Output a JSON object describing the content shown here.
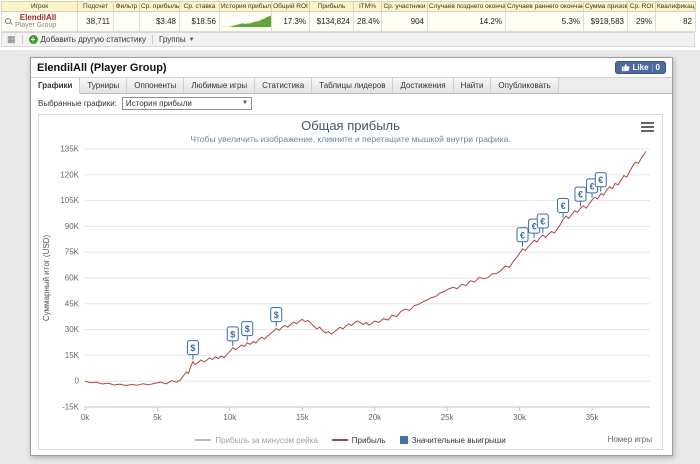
{
  "colors": {
    "accent_red": "#AA4643",
    "accent_blue": "#4572A7",
    "flag_blue": "#3c6aa6",
    "sparkline_green": "#63a33c",
    "header_bg": "#fbf4c6",
    "like_blue": "#4e69a2"
  },
  "table": {
    "headers": [
      "Игрок",
      "Подсчет",
      "Фильтр",
      "Ср. прибыль",
      "Ср. ставка",
      "История прибыли",
      "Общий ROI",
      "Прибыль",
      "ITM%",
      "Ср. участники",
      "Случаев позднего окончания",
      "Случаев раннего окончания",
      "Сумма призов",
      "Ср. ROI",
      "Квалификация"
    ],
    "row": {
      "player": "ElendilAll",
      "player_sub": "Player Group",
      "count": "38,711",
      "filter": "",
      "avg_profit": "$3.48",
      "avg_stake": "$18.56",
      "total_roi": "17.3%",
      "profit": "$134,824",
      "itm": "28.4%",
      "avg_entrants": "904",
      "late_finish": "14.2%",
      "early_finish": "5.3%",
      "total_prizes": "$918,583",
      "avg_roi": "29%",
      "qualification": "82"
    }
  },
  "toolbar": {
    "add_stat": "Добавить другую статистику",
    "groups": "Группы"
  },
  "panel": {
    "title": "ElendilAll (Player Group)",
    "like_label": "Like",
    "like_count": "0",
    "tabs": [
      "Графики",
      "Турниры",
      "Оппоненты",
      "Любимые игры",
      "Статистика",
      "Таблицы лидеров",
      "Достижения",
      "Найти",
      "Опубликовать"
    ],
    "selected_graphs_label": "Выбранные графики:",
    "selected_graph": "История прибыли"
  },
  "chart_data": {
    "type": "line",
    "title": "Общая прибыль",
    "subtitle": "Чтобы увеличить изображение, кликните и перетащите мышкой внутри графика.",
    "xlabel": "Номер игры",
    "ylabel": "Суммарный итог (USD)",
    "y_unit": "thousand USD",
    "xlim": [
      0,
      39
    ],
    "ylim": [
      -15,
      135
    ],
    "grid": "horizontal",
    "legend_position": "bottom",
    "xticks": {
      "values": [
        0,
        5,
        10,
        15,
        20,
        25,
        30,
        35
      ],
      "labels": [
        "0k",
        "5k",
        "10k",
        "15k",
        "20k",
        "25k",
        "30k",
        "35k"
      ]
    },
    "yticks": {
      "values": [
        -15,
        0,
        15,
        30,
        45,
        60,
        75,
        90,
        105,
        120,
        135
      ],
      "labels": [
        "-15K",
        "0",
        "15K",
        "30K",
        "45K",
        "60K",
        "75K",
        "90K",
        "105K",
        "120K",
        "135K"
      ]
    },
    "legend": [
      {
        "label": "Прибыль за минусом рейка",
        "type": "line",
        "color": "#b8b8b8",
        "text_color": "#a0a0a0"
      },
      {
        "label": "Прибыль",
        "type": "line",
        "color": "#AA4643",
        "text_color": "#333333"
      },
      {
        "label": "Значительные выигрыши",
        "type": "square",
        "color": "#4572A7",
        "text_color": "#333333"
      }
    ],
    "series": [
      {
        "name": "Прибыль",
        "color": "#AA4643",
        "points": [
          [
            0,
            0
          ],
          [
            0.4,
            -0.9
          ],
          [
            0.8,
            -0.5
          ],
          [
            1.2,
            -1.6
          ],
          [
            1.6,
            -1.1
          ],
          [
            2,
            -2.2
          ],
          [
            2.4,
            -1.7
          ],
          [
            2.8,
            -2.5
          ],
          [
            3.2,
            -1.9
          ],
          [
            3.6,
            -2.4
          ],
          [
            4,
            -1.5
          ],
          [
            4.4,
            -2.1
          ],
          [
            4.8,
            -1.3
          ],
          [
            5.2,
            -0.6
          ],
          [
            5.6,
            -1.5
          ],
          [
            6,
            0.3
          ],
          [
            6.3,
            -0.5
          ],
          [
            6.6,
            0.8
          ],
          [
            6.8,
            3.2
          ],
          [
            7,
            5.4
          ],
          [
            7.15,
            4.6
          ],
          [
            7.3,
            8.6
          ],
          [
            7.45,
            11.4
          ],
          [
            7.6,
            9.6
          ],
          [
            7.8,
            10.8
          ],
          [
            8,
            12.4
          ],
          [
            8.2,
            11.2
          ],
          [
            8.4,
            12.2
          ],
          [
            8.6,
            13.6
          ],
          [
            8.8,
            12.6
          ],
          [
            9,
            14.1
          ],
          [
            9.2,
            13.2
          ],
          [
            9.4,
            14.6
          ],
          [
            9.6,
            13.7
          ],
          [
            9.8,
            15.6
          ],
          [
            10,
            17.4
          ],
          [
            10.2,
            19.4
          ],
          [
            10.4,
            18.4
          ],
          [
            10.6,
            19.6
          ],
          [
            10.8,
            21
          ],
          [
            11,
            20.2
          ],
          [
            11.2,
            22.4
          ],
          [
            11.4,
            21.4
          ],
          [
            11.6,
            23.1
          ],
          [
            11.8,
            22.2
          ],
          [
            12,
            24.2
          ],
          [
            12.2,
            25.6
          ],
          [
            12.4,
            24.6
          ],
          [
            12.6,
            26.2
          ],
          [
            12.8,
            27.6
          ],
          [
            13,
            29
          ],
          [
            13.2,
            30.6
          ],
          [
            13.4,
            29.6
          ],
          [
            13.6,
            31.2
          ],
          [
            13.8,
            32.4
          ],
          [
            14,
            31.4
          ],
          [
            14.2,
            33
          ],
          [
            14.4,
            34.4
          ],
          [
            14.6,
            33.4
          ],
          [
            14.8,
            35
          ],
          [
            15,
            36
          ],
          [
            15.2,
            34.6
          ],
          [
            15.4,
            35.4
          ],
          [
            15.6,
            33.6
          ],
          [
            15.8,
            32
          ],
          [
            16,
            30.4
          ],
          [
            16.2,
            31.4
          ],
          [
            16.4,
            29.4
          ],
          [
            16.6,
            28
          ],
          [
            16.8,
            28.8
          ],
          [
            17,
            27.4
          ],
          [
            17.2,
            28.6
          ],
          [
            17.4,
            30
          ],
          [
            17.6,
            31.4
          ],
          [
            17.8,
            30.4
          ],
          [
            18,
            32
          ],
          [
            18.2,
            33.4
          ],
          [
            18.4,
            32.4
          ],
          [
            18.6,
            34
          ],
          [
            18.8,
            35
          ],
          [
            19,
            34
          ],
          [
            19.2,
            33
          ],
          [
            19.4,
            34.1
          ],
          [
            19.6,
            32.6
          ],
          [
            19.8,
            33.6
          ],
          [
            20,
            35
          ],
          [
            20.3,
            34.2
          ],
          [
            20.6,
            36.4
          ],
          [
            20.9,
            35.6
          ],
          [
            21.2,
            38.4
          ],
          [
            21.5,
            37.6
          ],
          [
            21.8,
            40.4
          ],
          [
            22.1,
            42
          ],
          [
            22.4,
            41.2
          ],
          [
            22.7,
            43.8
          ],
          [
            23,
            44.6
          ],
          [
            23.3,
            46
          ],
          [
            23.6,
            47.2
          ],
          [
            23.9,
            48.6
          ],
          [
            24.2,
            49.2
          ],
          [
            24.5,
            51.2
          ],
          [
            24.8,
            52.2
          ],
          [
            25.1,
            53.6
          ],
          [
            25.4,
            54.6
          ],
          [
            25.7,
            53.8
          ],
          [
            26,
            56.4
          ],
          [
            26.3,
            55.6
          ],
          [
            26.6,
            58.4
          ],
          [
            26.9,
            57.6
          ],
          [
            27.2,
            60.4
          ],
          [
            27.5,
            59.6
          ],
          [
            27.8,
            60.2
          ],
          [
            28.1,
            62.4
          ],
          [
            28.4,
            62.6
          ],
          [
            28.7,
            64.2
          ],
          [
            29,
            67
          ],
          [
            29.3,
            66.2
          ],
          [
            29.6,
            70
          ],
          [
            29.8,
            72
          ],
          [
            30,
            74.4
          ],
          [
            30.2,
            77
          ],
          [
            30.4,
            76
          ],
          [
            30.6,
            78.2
          ],
          [
            30.8,
            80
          ],
          [
            31,
            82
          ],
          [
            31.2,
            81
          ],
          [
            31.4,
            83.4
          ],
          [
            31.6,
            85
          ],
          [
            31.8,
            83.6
          ],
          [
            32,
            85.6
          ],
          [
            32.2,
            87
          ],
          [
            32.4,
            86.2
          ],
          [
            32.6,
            88.6
          ],
          [
            32.8,
            91
          ],
          [
            33,
            94
          ],
          [
            33.2,
            96
          ],
          [
            33.4,
            94.6
          ],
          [
            33.6,
            97
          ],
          [
            33.8,
            99
          ],
          [
            34,
            98.2
          ],
          [
            34.2,
            100.6
          ],
          [
            34.4,
            102
          ],
          [
            34.6,
            100.6
          ],
          [
            34.8,
            103
          ],
          [
            35,
            105.4
          ],
          [
            35.2,
            107
          ],
          [
            35.4,
            106
          ],
          [
            35.6,
            109
          ],
          [
            35.8,
            108.2
          ],
          [
            36,
            111
          ],
          [
            36.2,
            113
          ],
          [
            36.4,
            112
          ],
          [
            36.6,
            115
          ],
          [
            36.8,
            114.2
          ],
          [
            37,
            117
          ],
          [
            37.2,
            119.6
          ],
          [
            37.4,
            118.6
          ],
          [
            37.6,
            122
          ],
          [
            37.8,
            125
          ],
          [
            38,
            127.4
          ],
          [
            38.2,
            126.6
          ],
          [
            38.4,
            129.6
          ],
          [
            38.6,
            132
          ],
          [
            38.71,
            133.6
          ]
        ]
      }
    ],
    "markers": [
      {
        "x": 7.45,
        "y": 11.4,
        "symbol": "$"
      },
      {
        "x": 10.2,
        "y": 19.4,
        "symbol": "$"
      },
      {
        "x": 11.2,
        "y": 22.4,
        "symbol": "$"
      },
      {
        "x": 13.2,
        "y": 30.6,
        "symbol": "$"
      },
      {
        "x": 30.2,
        "y": 77,
        "symbol": "€"
      },
      {
        "x": 31.0,
        "y": 82,
        "symbol": "€"
      },
      {
        "x": 31.6,
        "y": 85,
        "symbol": "€"
      },
      {
        "x": 33.0,
        "y": 94,
        "symbol": "€"
      },
      {
        "x": 34.2,
        "y": 100.6,
        "symbol": "€"
      },
      {
        "x": 35.0,
        "y": 105.4,
        "symbol": "€"
      },
      {
        "x": 35.6,
        "y": 109,
        "symbol": "€"
      }
    ]
  }
}
